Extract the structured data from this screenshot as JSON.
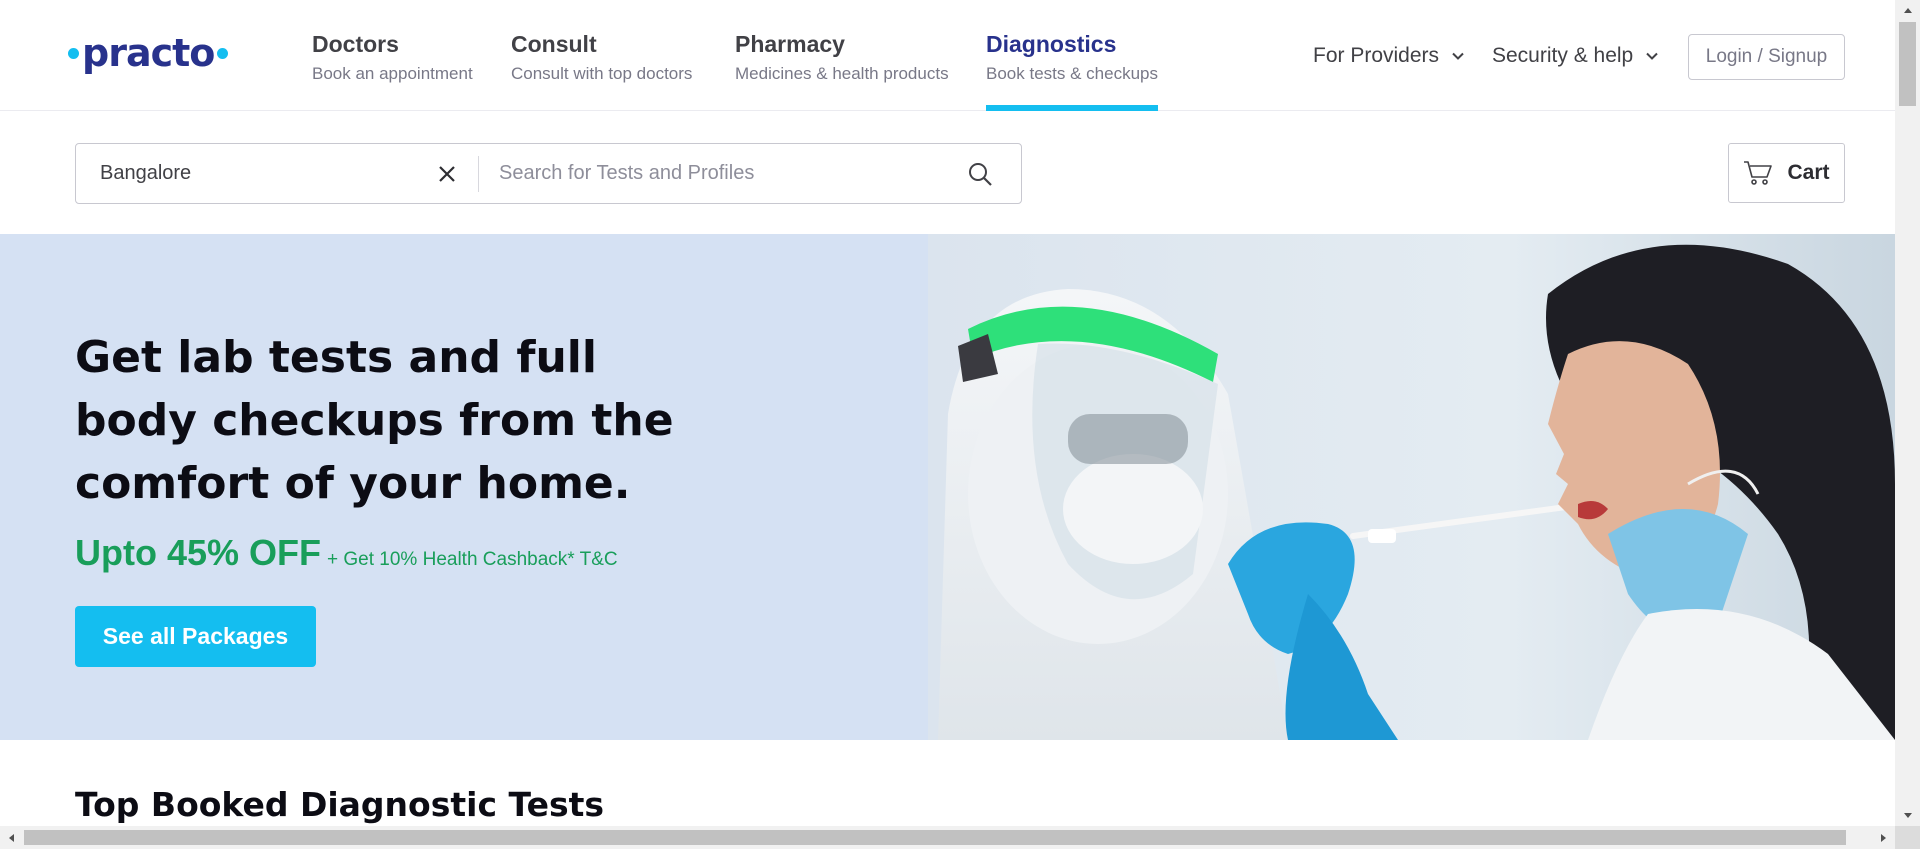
{
  "brand": {
    "logo_text": "practo"
  },
  "nav": {
    "items": [
      {
        "title": "Doctors",
        "subtitle": "Book an appointment"
      },
      {
        "title": "Consult",
        "subtitle": "Consult with top doctors"
      },
      {
        "title": "Pharmacy",
        "subtitle": "Medicines & health products"
      },
      {
        "title": "Diagnostics",
        "subtitle": "Book tests & checkups"
      }
    ],
    "active_index": 3,
    "for_providers": "For Providers",
    "security_help": "Security & help",
    "login_label": "Login / Signup"
  },
  "search": {
    "location_value": "Bangalore",
    "placeholder": "Search for Tests and Profiles"
  },
  "cart": {
    "label": "Cart"
  },
  "hero": {
    "title": "Get lab tests and full body checkups from the comfort of your home.",
    "offer_main": "Upto 45% OFF",
    "offer_extra": "+ Get 10% Health Cashback* T&C",
    "cta_label": "See all Packages"
  },
  "section": {
    "title": "Top Booked Diagnostic Tests"
  },
  "colors": {
    "accent": "#14bef0",
    "brand_navy": "#28328c",
    "offer_green": "#199e5a",
    "hero_bg": "#d5e1f3"
  },
  "icons": [
    "chevron-down-icon",
    "close-icon",
    "search-icon",
    "cart-icon",
    "scroll-arrow-icon"
  ]
}
